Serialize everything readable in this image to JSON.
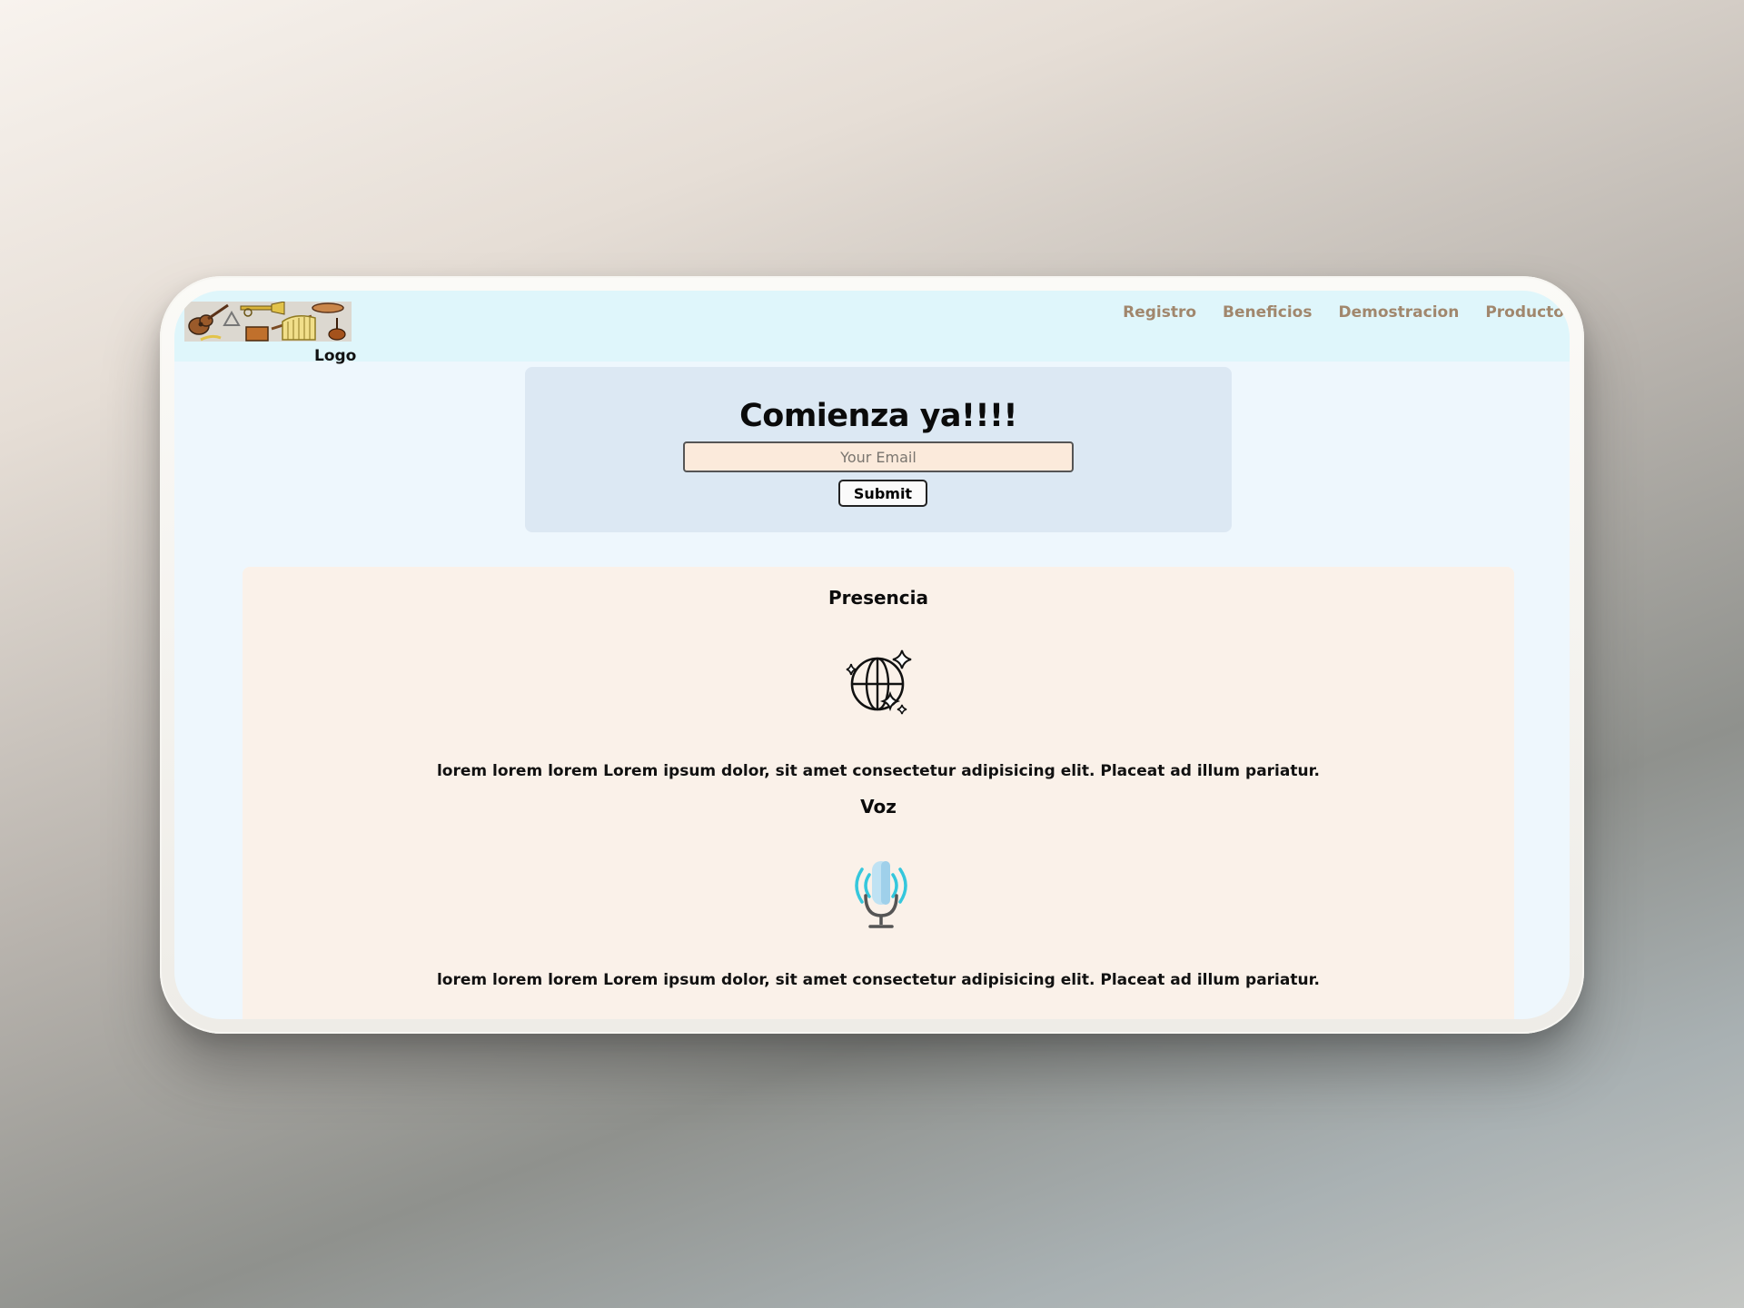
{
  "header": {
    "logo_label": "Logo",
    "nav": [
      "Registro",
      "Beneficios",
      "Demostracion",
      "Producto"
    ]
  },
  "signup": {
    "title": "Comienza ya!!!!",
    "email_placeholder": "Your Email",
    "submit_label": "Submit"
  },
  "features": [
    {
      "title": "Presencia",
      "icon": "globe-sparkle-icon",
      "text": "lorem lorem lorem Lorem ipsum dolor, sit amet consectetur adipisicing elit. Placeat ad illum pariatur."
    },
    {
      "title": "Voz",
      "icon": "microphone-icon",
      "text": "lorem lorem lorem Lorem ipsum dolor, sit amet consectetur adipisicing elit. Placeat ad illum pariatur."
    }
  ],
  "colors": {
    "header_bg": "#dff6fb",
    "nav_link": "#a1876d",
    "signup_bg": "#dce8f3",
    "features_bg": "#faf1e9",
    "input_bg": "#fbeadb"
  }
}
